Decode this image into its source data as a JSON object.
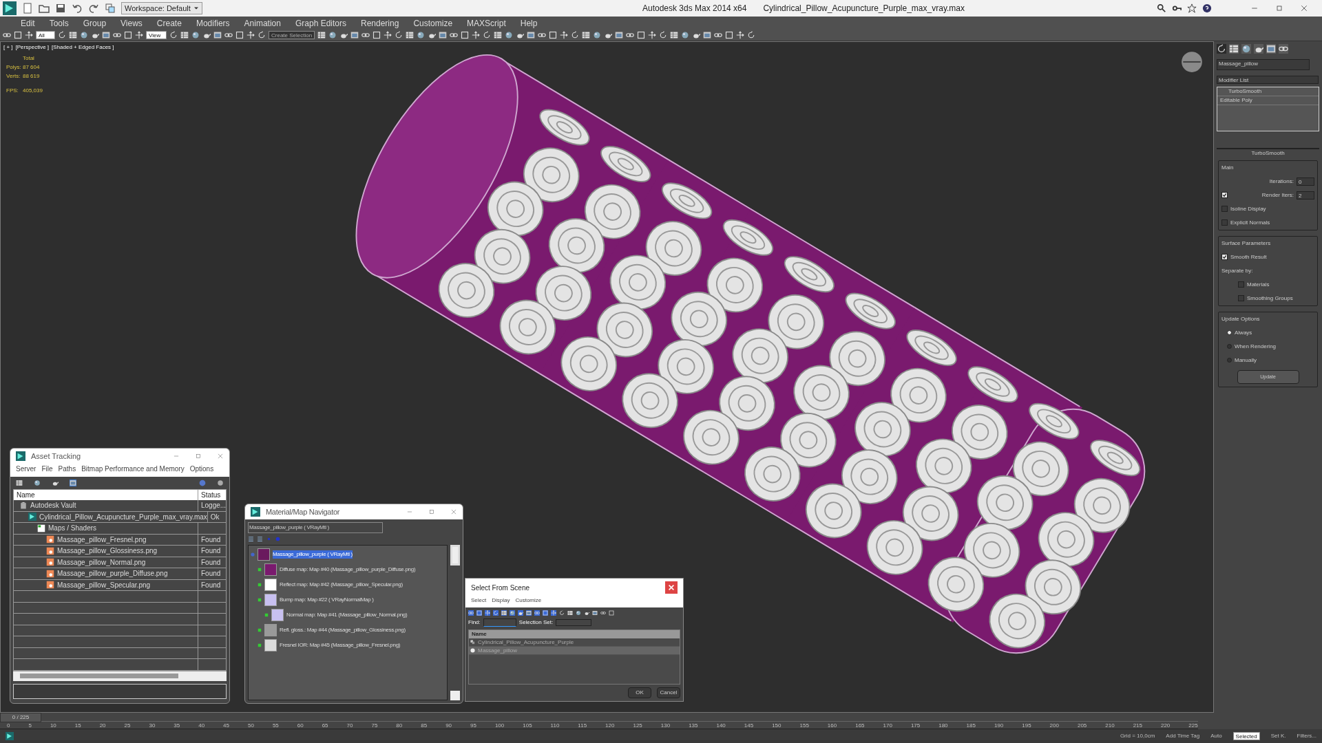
{
  "title_bar": {
    "workspace": "Workspace: Default",
    "app_name": "Autodesk 3ds Max  2014 x64",
    "file_name": "Cylindrical_Pillow_Acupuncture_Purple_max_vray.max"
  },
  "menu": [
    "Edit",
    "Tools",
    "Group",
    "Views",
    "Create",
    "Modifiers",
    "Animation",
    "Graph Editors",
    "Rendering",
    "Customize",
    "MAXScript",
    "Help"
  ],
  "toolbar": {
    "selection_filter": "All",
    "reference_coordinate": "View",
    "named_selection": "Create Selection"
  },
  "viewport": {
    "labels": [
      "[ + ]",
      "[Perspective ]",
      "[Shaded + Edged Faces ]"
    ],
    "stats_heading": "Total",
    "stats": [
      {
        "label": "Polys:",
        "value": "87 604"
      },
      {
        "label": "Verts:",
        "value": "88 619"
      },
      {
        "label": "FPS:",
        "value": "405,039"
      }
    ]
  },
  "command_panel": {
    "tabs": [
      {
        "selected": true
      },
      {
        "selected": false
      },
      {
        "selected": false
      },
      {
        "selected": false
      },
      {
        "selected": false
      },
      {
        "selected": false
      }
    ],
    "object_name": "Massage_pillow",
    "modifier_list": "Modifier List",
    "stack": [
      "TurboSmooth",
      "Editable Poly"
    ],
    "rollout": "TurboSmooth",
    "main": {
      "title": "Main",
      "iterations_label": "Iterations:",
      "iterations": "0",
      "render_iters_label": "Render Iters:",
      "render_iters": "2",
      "render_iters_checked": true,
      "checks": [
        {
          "label": "Isoline Display",
          "checked": false
        },
        {
          "label": "Explicit Normals",
          "checked": false
        }
      ]
    },
    "surface": {
      "title": "Surface Parameters",
      "smooth_result": {
        "label": "Smooth Result",
        "checked": true
      },
      "separate_by": "Separate by:",
      "checks": [
        {
          "label": "Materials",
          "checked": false
        },
        {
          "label": "Smoothing Groups",
          "checked": false
        }
      ]
    },
    "update": {
      "title": "Update Options",
      "options": [
        {
          "label": "Always",
          "selected": true
        },
        {
          "label": "When Rendering",
          "selected": false
        },
        {
          "label": "Manually",
          "selected": false
        }
      ],
      "button": "Update"
    }
  },
  "asset_tracking": {
    "title": "Asset Tracking",
    "menu": [
      "Server",
      "File",
      "Paths",
      "Bitmap Performance and Memory",
      "Options"
    ],
    "columns": [
      "Name",
      "Status"
    ],
    "rows": [
      {
        "kind": "vault",
        "name": "Autodesk Vault",
        "status": "Logge...",
        "children": [
          {
            "kind": "maxfile",
            "name": "Cylindrical_Pillow_Acupuncture_Purple_max_vray.max",
            "status": "Ok",
            "children": [
              {
                "kind": "folder",
                "name": "Maps / Shaders",
                "children": [
                  {
                    "kind": "image",
                    "name": "Massage_pillow_Fresnel.png",
                    "status": "Found"
                  },
                  {
                    "kind": "image",
                    "name": "Massage_pillow_Glossiness.png",
                    "status": "Found"
                  },
                  {
                    "kind": "image",
                    "name": "Massage_pillow_Normal.png",
                    "status": "Found"
                  },
                  {
                    "kind": "image",
                    "name": "Massage_pillow_purple_Diffuse.png",
                    "status": "Found"
                  },
                  {
                    "kind": "image",
                    "name": "Massage_pillow_Specular.png",
                    "status": "Found"
                  }
                ]
              }
            ]
          }
        ]
      }
    ]
  },
  "material_navigator": {
    "title": "Material/Map Navigator",
    "field": "Massage_pillow_purple  ( VRayMtl )",
    "tree": [
      {
        "name": "Massage_pillow_purple  ( VRayMtl )",
        "selected": true,
        "color": "#6a1a5e",
        "children": [
          {
            "name": "Diffuse map: Map #40 (Massage_pillow_purple_Diffuse.png)",
            "selected": false,
            "color": "#7a1a6e"
          },
          {
            "name": "Reflect map: Map #42 (Massage_pillow_Specular.png)",
            "selected": false,
            "color": "#ffffff"
          },
          {
            "name": "Bump map: Map #22  ( VRayNormalMap )",
            "selected": false,
            "color": "#c8c0f0",
            "children": [
              {
                "name": "Normal map: Map #41 (Massage_pillow_Normal.png)",
                "selected": false,
                "color": "#c8c0f0"
              }
            ]
          },
          {
            "name": "Refl. gloss.: Map #44 (Massage_pillow_Glossiness.png)",
            "selected": false,
            "color": "#9a9a9a"
          },
          {
            "name": "Fresnel IOR: Map #45 (Massage_pillow_Fresnel.png)",
            "selected": false,
            "color": "#dcdcdc"
          }
        ]
      }
    ]
  },
  "select_from_scene": {
    "title": "Select From Scene",
    "menu": [
      "Select",
      "Display",
      "Customize"
    ],
    "find_label": "Find:",
    "selection_set_label": "Selection Set:",
    "column": "Name",
    "rows": [
      {
        "name": "Cylindrical_Pillow_Acupuncture_Purple",
        "selected": false
      },
      {
        "name": "Massage_pillow",
        "selected": true
      }
    ],
    "buttons": [
      "OK",
      "Cancel"
    ]
  },
  "timeline": {
    "frame": "0 / 225",
    "level": 0,
    "ticks": [
      "0",
      "5",
      "10",
      "15",
      "20",
      "25",
      "30",
      "35",
      "40",
      "45",
      "50",
      "55",
      "60",
      "65",
      "70",
      "75",
      "80",
      "85",
      "90",
      "95",
      "100",
      "105",
      "110",
      "115",
      "120",
      "125",
      "130",
      "135",
      "140",
      "145",
      "150",
      "155",
      "160",
      "165",
      "170",
      "175",
      "180",
      "185",
      "190",
      "195",
      "200",
      "205",
      "210",
      "215",
      "220",
      "225"
    ]
  },
  "status_bar": {
    "grid": "Grid = 10,0cm",
    "time_tag": "Add Time Tag",
    "auto": "Auto",
    "selection": "Selected",
    "set_key": "Set K.",
    "filters": "Filters..."
  }
}
